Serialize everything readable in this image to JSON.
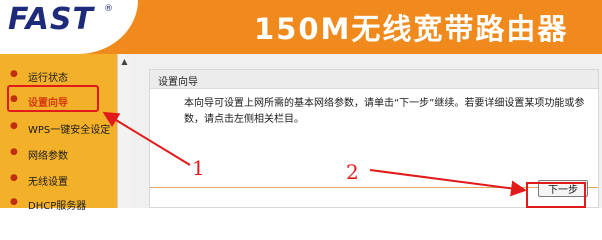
{
  "header": {
    "logo": "FAST",
    "logo_mark": "®",
    "product_title": "150M无线宽带路由器"
  },
  "sidebar": {
    "items": [
      {
        "label": "运行状态"
      },
      {
        "label": "设置向导",
        "active": true
      },
      {
        "label": "WPS一键安全设定"
      },
      {
        "label": "网络参数"
      },
      {
        "label": "无线设置"
      },
      {
        "label": "DHCP服务器"
      }
    ]
  },
  "scrollbar": {
    "up_arrow": "▲"
  },
  "panel": {
    "title": "设置向导",
    "description": "本向导可设置上网所需的基本网络参数，请单击“下一步”继续。若要详细设置某项功能或参数，请点击左侧相关栏目。",
    "next_button": "下一步"
  },
  "annotations": {
    "step1": "1",
    "step2": "2",
    "color": "#e11a1a"
  }
}
